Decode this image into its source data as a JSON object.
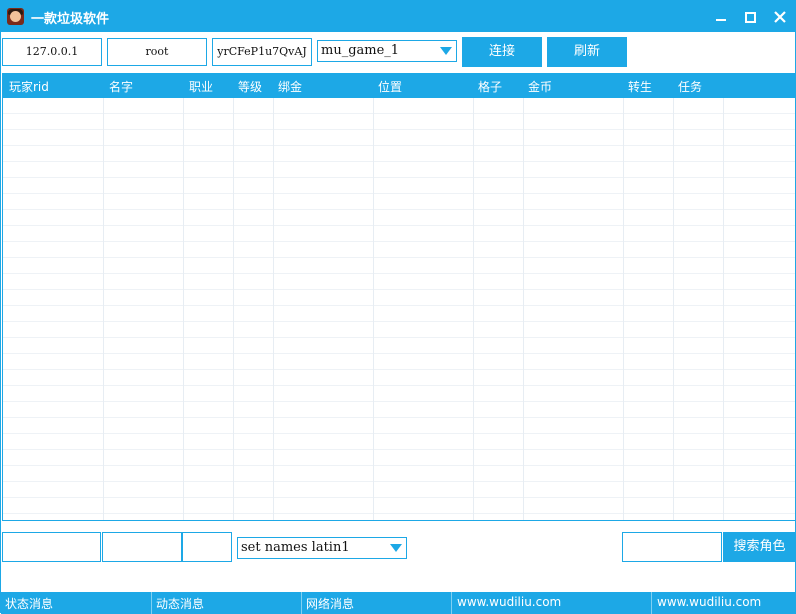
{
  "window": {
    "title": "一款垃圾软件"
  },
  "toolbar": {
    "host_value": "127.0.0.1",
    "user_value": "root",
    "password_value": "yrCFeP1u7QvAJ",
    "database_select": "mu_game_1",
    "connect_label": "连接",
    "refresh_label": "刷新"
  },
  "grid": {
    "columns": [
      "玩家rid",
      "名字",
      "职业",
      "等级",
      "绑金",
      "位置",
      "格子",
      "金币",
      "转生",
      "任务"
    ],
    "rows": []
  },
  "bottom": {
    "charset_select": "set names latin1",
    "search_label": "搜索角色"
  },
  "statusbar": {
    "status_msg": "状态消息",
    "dynamic_msg": "动态消息",
    "network_msg": "网络消息",
    "site1": "www.wudiliu.com",
    "site2": "www.wudiliu.com"
  },
  "colors": {
    "accent": "#1da8e6",
    "grid_line": "#eef2f6"
  }
}
